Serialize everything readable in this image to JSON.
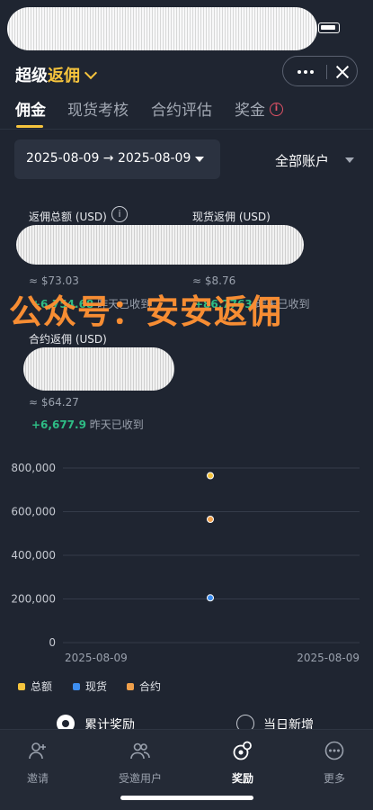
{
  "header": {
    "title_prefix": "超级",
    "title_accent": "返佣"
  },
  "tabs": [
    {
      "label": "佣金"
    },
    {
      "label": "现货考核"
    },
    {
      "label": "合约评估"
    },
    {
      "label": "奖金"
    }
  ],
  "filters": {
    "date_range": "2025-08-09 → 2025-08-09",
    "account": "全部账户"
  },
  "stats": {
    "total": {
      "label": "返佣总额 (USD)",
      "approx": "≈ $73.03",
      "gain": "+6,754.68",
      "gain_suffix": "昨天已收到"
    },
    "spot": {
      "label": "现货返佣 (USD)",
      "approx": "≈ $8.76",
      "gain": "+86.7763",
      "gain_suffix": "昨天已收到"
    },
    "futures": {
      "label": "合约返佣 (USD)",
      "approx": "≈ $64.27",
      "gain": "+6,677.9",
      "gain_suffix": "昨天已收到"
    }
  },
  "watermark": "公众号：安安返佣",
  "chart_data": {
    "type": "scatter",
    "categories": [
      "2025-08-09"
    ],
    "x_tick_labels": [
      "2025-08-09",
      "2025-08-09"
    ],
    "y_ticks": [
      "800,000",
      "600,000",
      "400,000",
      "200,000",
      "0"
    ],
    "ylim": [
      0,
      800000
    ],
    "grid": true,
    "legend_position": "bottom-left",
    "series": [
      {
        "name": "总额",
        "color": "#f6c43d",
        "values": [
          765000
        ]
      },
      {
        "name": "现货",
        "color": "#3d8ef0",
        "values": [
          205000
        ]
      },
      {
        "name": "合约",
        "color": "#f0a04b",
        "values": [
          565000
        ]
      }
    ]
  },
  "view_toggle": {
    "cumulative": "累计奖励",
    "daily": "当日新增"
  },
  "nav": [
    {
      "label": "邀请",
      "icon": "add-user-icon"
    },
    {
      "label": "受邀用户",
      "icon": "users-icon"
    },
    {
      "label": "奖励",
      "icon": "reward-icon"
    },
    {
      "label": "更多",
      "icon": "more-icon"
    }
  ]
}
